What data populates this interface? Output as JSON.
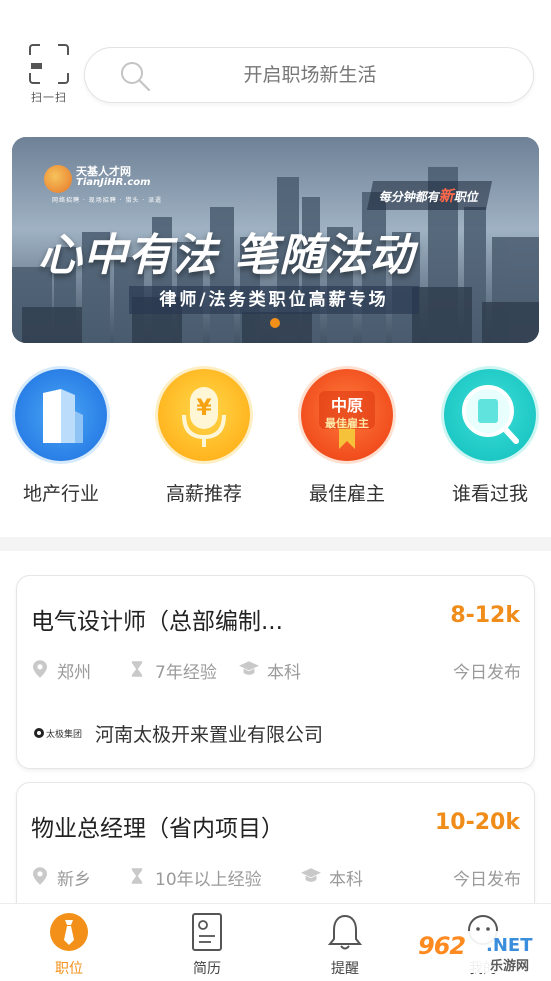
{
  "header": {
    "scan_label": "扫一扫",
    "search_placeholder": "开启职场新生活"
  },
  "banner": {
    "logo_name": "天基人才网",
    "logo_url": "TianJiHR.com",
    "logo_tags": "网络招聘 · 现场招聘 · 猎头 · 派遣",
    "note_prefix": "每分钟都有",
    "note_highlight": "新",
    "note_suffix": "职位",
    "headline": "心中有法  笔随法动",
    "subline": "律师/法务类职位高薪专场",
    "active_slide": 1
  },
  "quick_entries": [
    {
      "label": "地产行业",
      "icon": "building-icon"
    },
    {
      "label": "高薪推荐",
      "icon": "microphone-money-icon"
    },
    {
      "label": "最佳雇主",
      "icon": "badge-icon",
      "badge_line1": "中原",
      "badge_line2": "最佳雇主"
    },
    {
      "label": "谁看过我",
      "icon": "magnifier-icon"
    }
  ],
  "jobs": [
    {
      "title": "电气设计师（总部编制...",
      "salary": "8-12k",
      "city": "郑州",
      "experience": "7年经验",
      "education": "本科",
      "posted": "今日发布",
      "company": "河南太极开来置业有限公司",
      "company_logo_text": "太极集团"
    },
    {
      "title": "物业总经理（省内项目）",
      "salary": "10-20k",
      "city": "新乡",
      "experience": "10年以上经验",
      "education": "本科",
      "posted": "今日发布"
    }
  ],
  "tabbar": {
    "tabs": [
      {
        "label": "职位",
        "active": true
      },
      {
        "label": "简历",
        "active": false
      },
      {
        "label": "提醒",
        "active": false
      },
      {
        "label": "我的",
        "active": false
      }
    ]
  },
  "watermark": {
    "number": "962",
    "net": ".NET",
    "sub": "乐游网"
  },
  "colors": {
    "accent": "#f39019",
    "salary": "#f08c1a",
    "muted_text": "#9a9a9a"
  }
}
